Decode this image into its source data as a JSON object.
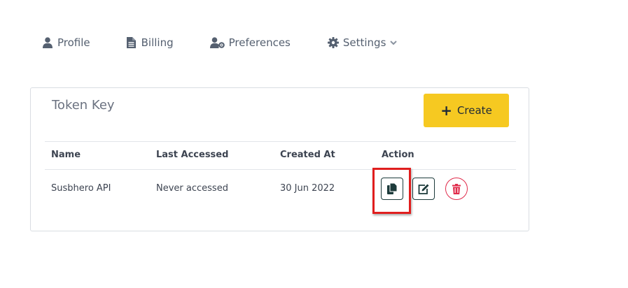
{
  "nav": {
    "items": [
      {
        "label": "Profile",
        "icon": "user-icon"
      },
      {
        "label": "Billing",
        "icon": "document-icon"
      },
      {
        "label": "Preferences",
        "icon": "user-cog-icon"
      },
      {
        "label": "Settings",
        "icon": "gear-icon",
        "dropdown": true
      }
    ]
  },
  "card": {
    "title": "Token Key",
    "create_label": "Create"
  },
  "table": {
    "headers": [
      "Name",
      "Last Accessed",
      "Created At",
      "Action"
    ],
    "rows": [
      {
        "name": "Susbhero API",
        "last_accessed": "Never accessed",
        "created_at": "30 Jun 2022"
      }
    ],
    "actions": [
      "copy-icon",
      "edit-icon",
      "trash-icon"
    ]
  },
  "colors": {
    "accent": "#f6c921",
    "action_border": "#1d3b3b",
    "danger": "#e02a4a",
    "highlight": "#e01e1e"
  }
}
